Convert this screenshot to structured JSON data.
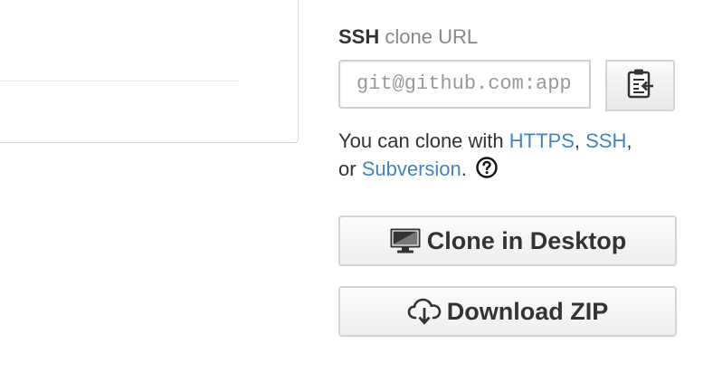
{
  "clone": {
    "protocol": "SSH",
    "title_suffix": "clone URL",
    "url_value": "git@github.com:app",
    "help_prefix": "You can clone with ",
    "https_label": "HTTPS",
    "separator1": ", ",
    "ssh_label": "SSH",
    "separator2": ",",
    "or_text": "or ",
    "subversion_label": "Subversion",
    "period": ".",
    "link_color": "#4183c4"
  },
  "buttons": {
    "desktop_label": "Clone in Desktop",
    "zip_label": "Download ZIP"
  },
  "icons": {
    "copy": "clipboard-icon",
    "help": "question-circle-icon",
    "desktop": "monitor-icon",
    "download": "cloud-download-icon"
  }
}
